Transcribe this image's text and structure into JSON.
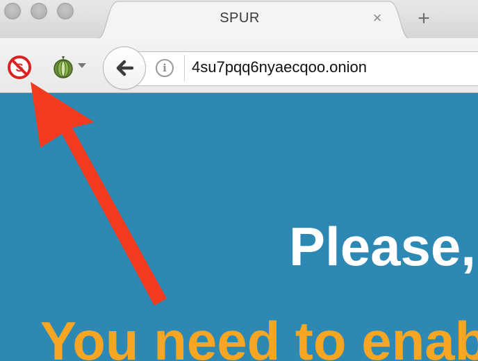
{
  "window": {
    "traffic_lights": [
      "close",
      "minimize",
      "zoom"
    ]
  },
  "tab": {
    "title": "SPUR",
    "close_glyph": "×",
    "new_tab_glyph": "+"
  },
  "toolbar": {
    "noscript_icon": "noscript-forbidden-icon",
    "onion_icon": "tor-onion-icon",
    "back_icon": "back-arrow-icon",
    "info_icon": "info-icon",
    "info_glyph": "i",
    "url": "4su7pqq6nyaecqoo.onion"
  },
  "page": {
    "heading": "Please,",
    "subheading": "You need to enab",
    "colors": {
      "background": "#2d89b4",
      "heading": "#ffffff",
      "subheading": "#f6a623",
      "annotation_arrow": "#f23a1e"
    }
  },
  "annotation": {
    "type": "red-arrow",
    "points_to": "noscript-button"
  }
}
